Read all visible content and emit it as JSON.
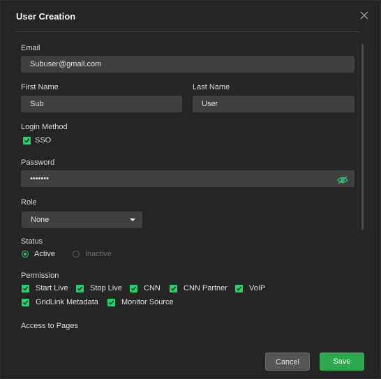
{
  "dialog": {
    "title": "User Creation"
  },
  "form": {
    "email_label": "Email",
    "email_value": "Subuser@gmail.com",
    "first_name_label": "First Name",
    "first_name_value": "Sub",
    "last_name_label": "Last Name",
    "last_name_value": "User",
    "login_method_label": "Login Method",
    "sso_label": "SSO",
    "password_label": "Password",
    "password_value": "•••••••",
    "role_label": "Role",
    "role_value": "None",
    "status_label": "Status",
    "status_active": "Active",
    "status_inactive": "Inactive",
    "permission_label": "Permission",
    "permissions": [
      "Start Live",
      "Stop Live",
      "CNN",
      "CNN Partner",
      "VoIP",
      "GridLink Metadata",
      "Monitor Source"
    ],
    "access_label": "Access to Pages"
  },
  "buttons": {
    "cancel": "Cancel",
    "save": "Save"
  },
  "colors": {
    "accent": "#2ecc71",
    "save": "#2ea84f"
  }
}
